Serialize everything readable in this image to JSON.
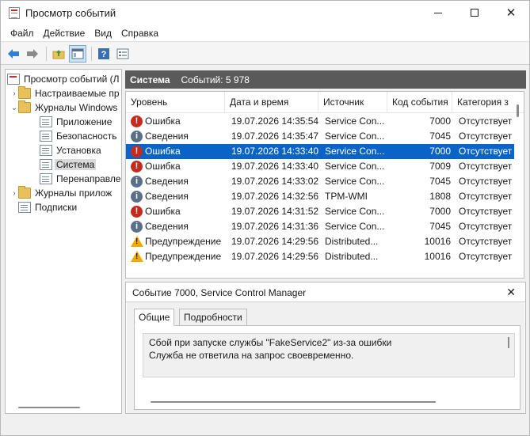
{
  "window": {
    "title": "Просмотр событий"
  },
  "menu": [
    {
      "label": "Файл"
    },
    {
      "label": "Действие"
    },
    {
      "label": "Вид"
    },
    {
      "label": "Справка"
    }
  ],
  "toolbar": {
    "icons": [
      "back-icon",
      "forward-icon",
      "up-folder-icon",
      "show-hide-tree-icon",
      "help-icon",
      "properties-icon"
    ]
  },
  "tree": {
    "items": [
      {
        "label": "Просмотр событий (Л",
        "icon": "event-viewer-icon",
        "arrow": "",
        "level": 0
      },
      {
        "label": "Настраиваемые пр",
        "icon": "folder-icon",
        "arrow": "›",
        "level": 1
      },
      {
        "label": "Журналы Windows",
        "icon": "folder-icon",
        "arrow": "⌄",
        "level": 1
      },
      {
        "label": "Приложение",
        "icon": "log-icon",
        "arrow": "",
        "level": 2
      },
      {
        "label": "Безопасность",
        "icon": "log-icon",
        "arrow": "",
        "level": 2
      },
      {
        "label": "Установка",
        "icon": "log-icon",
        "arrow": "",
        "level": 2
      },
      {
        "label": "Система",
        "icon": "log-icon",
        "arrow": "",
        "level": 2,
        "selected": true
      },
      {
        "label": "Перенаправле",
        "icon": "log-icon",
        "arrow": "",
        "level": 2
      },
      {
        "label": "Журналы прилож",
        "icon": "folder-icon",
        "arrow": "›",
        "level": 1
      },
      {
        "label": "Подписки",
        "icon": "log-icon",
        "arrow": "",
        "level": 1
      }
    ]
  },
  "log_header": {
    "name": "Система",
    "count_text": "Событий: 5 978"
  },
  "events": {
    "columns": [
      "Уровень",
      "Дата и время",
      "Источник",
      "Код события",
      "Категория з"
    ],
    "rows": [
      {
        "level": "Ошибка",
        "kind": "error",
        "datetime": "19.07.2026 14:35:54",
        "source": "Service Con...",
        "code": "7000",
        "category": "Отсутствует"
      },
      {
        "level": "Сведения",
        "kind": "info",
        "datetime": "19.07.2026 14:35:47",
        "source": "Service Con...",
        "code": "7045",
        "category": "Отсутствует"
      },
      {
        "level": "Ошибка",
        "kind": "error",
        "datetime": "19.07.2026 14:33:40",
        "source": "Service Con...",
        "code": "7000",
        "category": "Отсутствует",
        "selected": true
      },
      {
        "level": "Ошибка",
        "kind": "error",
        "datetime": "19.07.2026 14:33:40",
        "source": "Service Con...",
        "code": "7009",
        "category": "Отсутствует"
      },
      {
        "level": "Сведения",
        "kind": "info",
        "datetime": "19.07.2026 14:33:02",
        "source": "Service Con...",
        "code": "7045",
        "category": "Отсутствует"
      },
      {
        "level": "Сведения",
        "kind": "info",
        "datetime": "19.07.2026 14:32:56",
        "source": "TPM-WMI",
        "code": "1808",
        "category": "Отсутствует"
      },
      {
        "level": "Ошибка",
        "kind": "error",
        "datetime": "19.07.2026 14:31:52",
        "source": "Service Con...",
        "code": "7000",
        "category": "Отсутствует"
      },
      {
        "level": "Сведения",
        "kind": "info",
        "datetime": "19.07.2026 14:31:36",
        "source": "Service Con...",
        "code": "7045",
        "category": "Отсутствует"
      },
      {
        "level": "Предупреждение",
        "kind": "warn",
        "datetime": "19.07.2026 14:29:56",
        "source": "Distributed...",
        "code": "10016",
        "category": "Отсутствует"
      },
      {
        "level": "Предупреждение",
        "kind": "warn",
        "datetime": "19.07.2026 14:29:56",
        "source": "Distributed...",
        "code": "10016",
        "category": "Отсутствует"
      }
    ]
  },
  "detail": {
    "title": "Событие 7000, Service Control Manager",
    "close": "✕",
    "tabs": [
      "Общие",
      "Подробности"
    ],
    "message_lines": [
      "Сбой при запуске службы \"FakeService2\" из-за ошибки",
      "Служба не ответила на запрос своевременно."
    ]
  }
}
